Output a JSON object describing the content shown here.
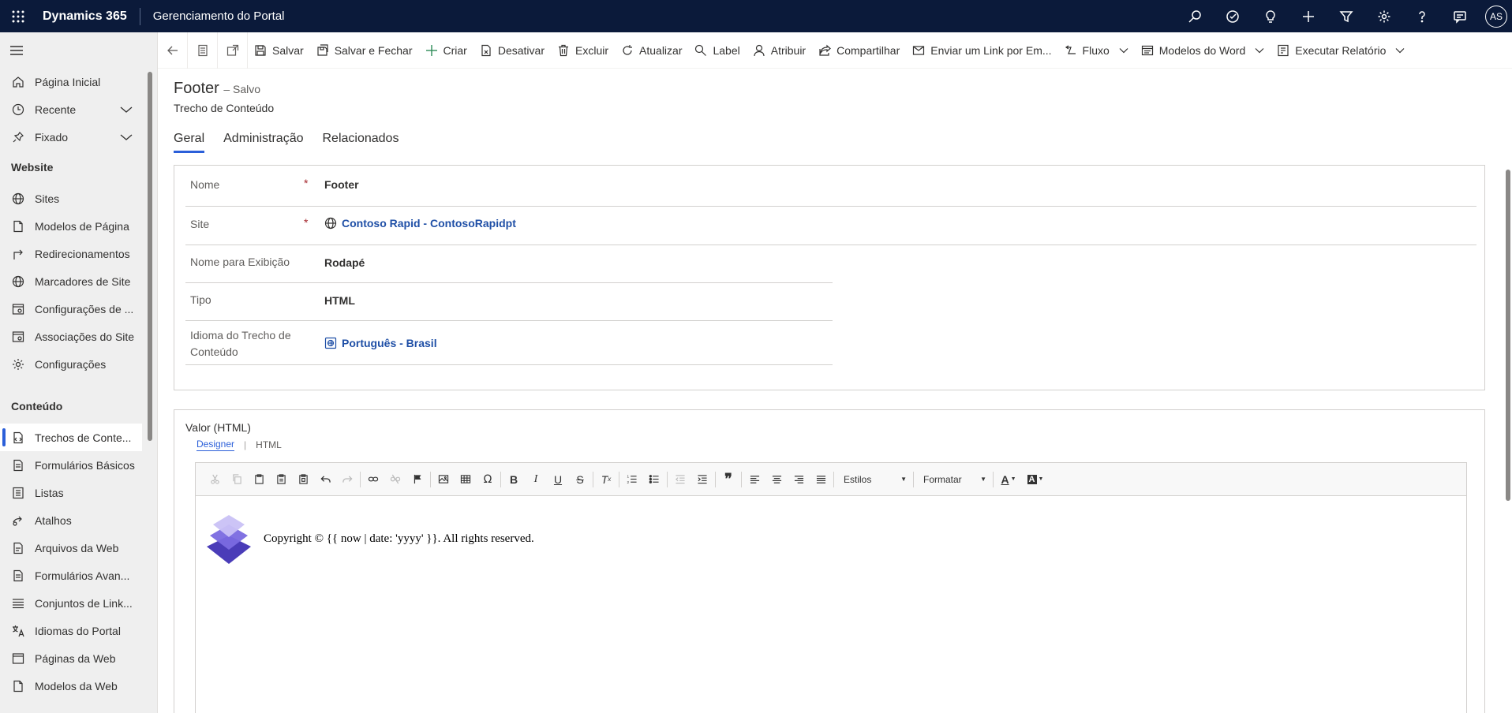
{
  "app": {
    "name": "Dynamics 365",
    "site_name": "Gerenciamento do Portal",
    "user_initials": "AS"
  },
  "topbar_icons": [
    "search-icon",
    "target-icon",
    "lightbulb-icon",
    "plus-icon",
    "filter-icon",
    "gear-icon",
    "help-icon",
    "chat-icon"
  ],
  "sidebar": {
    "top_items": [
      {
        "label": "Página Inicial",
        "icon": "home-icon"
      },
      {
        "label": "Recente",
        "icon": "clock-icon"
      },
      {
        "label": "Fixado",
        "icon": "pin-icon"
      }
    ],
    "groups": [
      {
        "title": "Website",
        "items": [
          {
            "label": "Sites",
            "icon": "globe-icon"
          },
          {
            "label": "Modelos de Página",
            "icon": "page-icon"
          },
          {
            "label": "Redirecionamentos",
            "icon": "redirect-icon"
          },
          {
            "label": "Marcadores de Site",
            "icon": "globe-icon"
          },
          {
            "label": "Configurações de ...",
            "icon": "settings-page-icon"
          },
          {
            "label": "Associações do Site",
            "icon": "settings-page-icon"
          },
          {
            "label": "Configurações",
            "icon": "gear-icon"
          }
        ]
      },
      {
        "title": "Conteúdo",
        "items": [
          {
            "label": "Trechos de Conte...",
            "icon": "snippet-icon",
            "active": true
          },
          {
            "label": "Formulários Básicos",
            "icon": "form-icon"
          },
          {
            "label": "Listas",
            "icon": "list-icon"
          },
          {
            "label": "Atalhos",
            "icon": "shortcut-icon"
          },
          {
            "label": "Arquivos da Web",
            "icon": "file-icon"
          },
          {
            "label": "Formulários Avan...",
            "icon": "form-icon"
          },
          {
            "label": "Conjuntos de Link...",
            "icon": "lines-icon"
          },
          {
            "label": "Idiomas do Portal",
            "icon": "language-icon"
          },
          {
            "label": "Páginas da Web",
            "icon": "web-page-icon"
          },
          {
            "label": "Modelos da Web",
            "icon": "page-icon"
          }
        ]
      }
    ]
  },
  "commands": {
    "save": "Salvar",
    "save_close": "Salvar e Fechar",
    "create": "Criar",
    "deactivate": "Desativar",
    "delete": "Excluir",
    "refresh": "Atualizar",
    "label": "Label",
    "assign": "Atribuir",
    "share": "Compartilhar",
    "email_link": "Enviar um Link por Em...",
    "flow": "Fluxo",
    "word_templates": "Modelos do Word",
    "run_report": "Executar Relatório"
  },
  "record": {
    "title": "Footer",
    "status": "– Salvo",
    "entity": "Trecho de Conteúdo"
  },
  "tabs": [
    "Geral",
    "Administração",
    "Relacionados"
  ],
  "fields": {
    "name_label": "Nome",
    "name_value": "Footer",
    "site_label": "Site",
    "site_value": "Contoso Rapid - ContosoRapidpt",
    "display_label": "Nome para Exibição",
    "display_value": "Rodapé",
    "type_label": "Tipo",
    "type_value": "HTML",
    "language_label": "Idioma do Trecho de Conteúdo",
    "language_value": "Português - Brasil",
    "required_mark": "*"
  },
  "editor": {
    "section_label": "Valor (HTML)",
    "tab_designer": "Designer",
    "tab_html": "HTML",
    "styles_combo": "Estilos",
    "format_combo": "Formatar",
    "content_text": "Copyright © {{ now | date: 'yyyy' }}. All rights reserved."
  }
}
